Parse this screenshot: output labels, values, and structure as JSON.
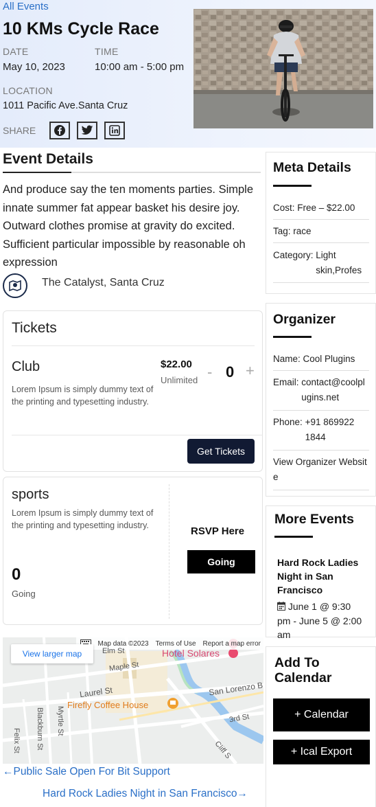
{
  "header": {
    "all_events": "All Events",
    "title": "10 KMs Cycle Race",
    "date_label": "DATE",
    "date_value": "May 10, 2023",
    "time_label": "TIME",
    "time_value": "10:00 am - 5:00 pm",
    "location_label": "LOCATION",
    "location_value": "1011 Pacific Ave.Santa Cruz",
    "share_label": "SHARE",
    "share_icons": [
      "facebook-icon",
      "twitter-icon",
      "linkedin-icon"
    ]
  },
  "details": {
    "title": "Event Details",
    "description": "And produce say the ten moments parties. Simple innate summer fat appear basket his desire joy. Outward clothes promise at gravity do excited. Sufficient particular impossible by reasonable oh expression",
    "venue": "The Catalyst, Santa Cruz"
  },
  "tickets": {
    "title": "Tickets",
    "name": "Club",
    "description": "Lorem Ipsum is simply dummy text of the printing and typesetting industry.",
    "price": "$22.00",
    "availability": "Unlimited",
    "minus": "-",
    "quantity": "0",
    "plus": "+",
    "button": "Get Tickets"
  },
  "rsvp": {
    "name": "sports",
    "description": "Lorem Ipsum is simply dummy text of the printing and typesetting industry.",
    "count": "0",
    "count_label": "Going",
    "heading": "RSVP Here",
    "button": "Going"
  },
  "map": {
    "larger_map": "View larger map",
    "attribution": "Map data ©2023",
    "terms": "Terms of Use",
    "report": "Report a map error",
    "labels": {
      "hotel": "Hotel Solares",
      "coffee": "Firefly Coffee House",
      "elm": "Elm St",
      "maple": "Maple St",
      "laurel": "Laurel St",
      "san_lorenzo": "San Lorenzo B",
      "third": "3rd St",
      "felix": "Felix St",
      "blackburn": "Blackburn St",
      "myrtle": "Myrtle St",
      "cliff": "Cliff S"
    }
  },
  "navigation": {
    "prev": "←Public Sale Open For Bit Support",
    "next": "Hard Rock Ladies Night in San Francisco→"
  },
  "sidebar": {
    "meta": {
      "title": "Meta Details",
      "cost_label": "Cost:",
      "cost_value": "Free – $22.00",
      "tag_label": "Tag:",
      "tag_value": "race",
      "category_label": "Category:",
      "category_value": "Light skin,Profes"
    },
    "organizer": {
      "title": "Organizer",
      "name_label": "Name:",
      "name_value": "Cool Plugins",
      "email_label": "Email:",
      "email_value": "contact@coolplugins.net",
      "phone_label": "Phone:",
      "phone_value": "+91 869922 1844",
      "website": "View Organizer Website"
    },
    "more_events": {
      "title": "More Events",
      "event_title": "Hard Rock Ladies Night in San Francisco",
      "event_date": "June 1 @ 9:30 pm - June 5 @ 2:00 am"
    },
    "calendar": {
      "title_line1": "Add To",
      "title_line2": "Calendar",
      "calendar_button": "+ Calendar",
      "ical_button": "+ Ical Export"
    }
  }
}
